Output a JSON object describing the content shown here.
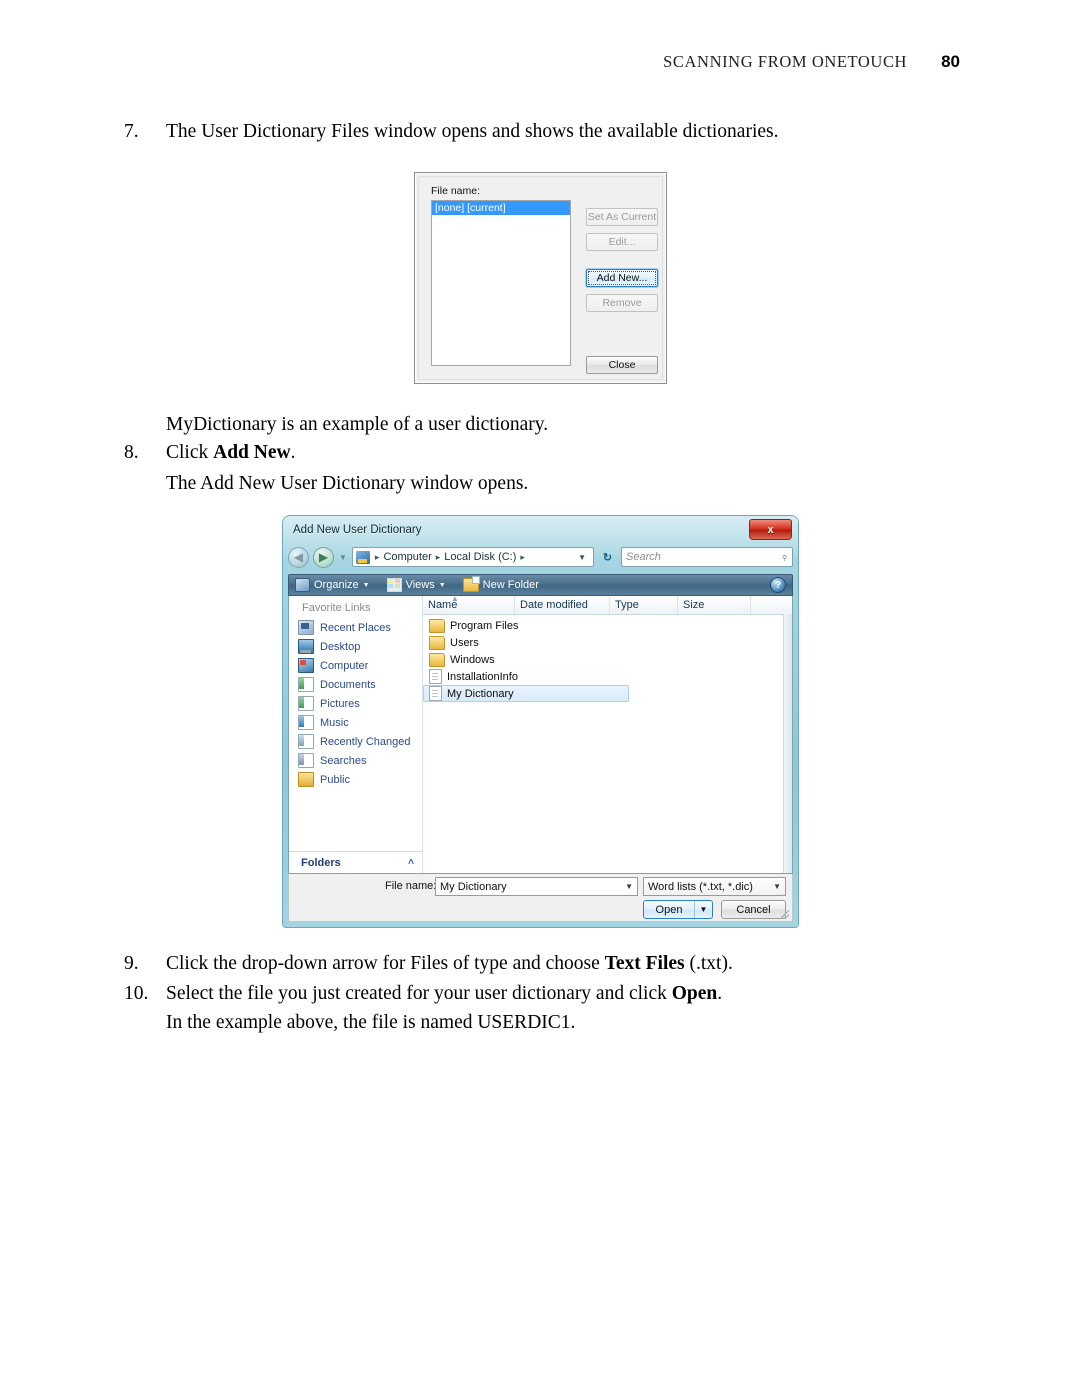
{
  "header": {
    "title": "SCANNING FROM ONETOUCH",
    "page_number": "80"
  },
  "steps": {
    "step7_num": "7.",
    "step7_text": "The User Dictionary Files window opens and shows the available dictionaries.",
    "mydictionary_note": "MyDictionary is an example of a user dictionary.",
    "step8_num": "8.",
    "step8_text_pre": "Click ",
    "step8_text_bold": "Add New",
    "step8_text_post": ".",
    "step8_note": "The Add New User Dictionary window opens.",
    "step9_num": "9.",
    "step9_text_pre": "Click the drop-down arrow for Files of type and choose ",
    "step9_text_bold": "Text Files",
    "step9_text_post": " (.txt).",
    "step10_num": "10.",
    "step10_text_pre": "Select the file you just created for your user dictionary and click ",
    "step10_text_bold": "Open",
    "step10_text_post": ".",
    "step10_note": "In the example above, the file is named USERDIC1."
  },
  "dictionary_dialog": {
    "file_name_label": "File name:",
    "list_items": [
      "[none] [current]"
    ],
    "buttons": {
      "set_as_current": "Set As Current",
      "edit": "Edit...",
      "add_new": "Add New...",
      "remove": "Remove",
      "close": "Close"
    }
  },
  "file_dialog": {
    "title": "Add New User Dictionary",
    "close_glyph": "x",
    "address": {
      "crumbs": [
        "Computer",
        "Local Disk (C:)"
      ],
      "separator": "▸",
      "dropdown_glyph": "▼",
      "refresh_glyph": "↻"
    },
    "search": {
      "placeholder": "Search",
      "icon_glyph": "⌕"
    },
    "toolbar": {
      "organize": "Organize",
      "views": "Views",
      "new_folder": "New Folder",
      "caret_glyph": "▼",
      "help_glyph": "?"
    },
    "sidebar": {
      "title": "Favorite Links",
      "items": [
        {
          "label": "Recent Places",
          "icon": "recent-places-icon"
        },
        {
          "label": "Desktop",
          "icon": "desktop-icon"
        },
        {
          "label": "Computer",
          "icon": "computer-icon"
        },
        {
          "label": "Documents",
          "icon": "documents-icon"
        },
        {
          "label": "Pictures",
          "icon": "pictures-icon"
        },
        {
          "label": "Music",
          "icon": "music-icon"
        },
        {
          "label": "Recently Changed",
          "icon": "recently-changed-icon"
        },
        {
          "label": "Searches",
          "icon": "searches-icon"
        },
        {
          "label": "Public",
          "icon": "public-folder-icon"
        }
      ],
      "folders_label": "Folders",
      "folders_chevron": "˄"
    },
    "columns": [
      "Name",
      "Date modified",
      "Type",
      "Size"
    ],
    "files": [
      {
        "name": "Program Files",
        "kind": "folder",
        "selected": false
      },
      {
        "name": "Users",
        "kind": "folder",
        "selected": false
      },
      {
        "name": "Windows",
        "kind": "folder",
        "selected": false
      },
      {
        "name": "InstallationInfo",
        "kind": "document",
        "selected": false
      },
      {
        "name": "My Dictionary",
        "kind": "document",
        "selected": true
      }
    ],
    "footer": {
      "file_name_label": "File name:",
      "file_name_value": "My Dictionary",
      "file_type_value": "Word lists (*.txt, *.dic)",
      "open_label": "Open",
      "open_caret": "▼",
      "cancel_label": "Cancel",
      "caret_glyph": "▼"
    }
  },
  "colors": {
    "selection_blue": "#3399ff",
    "link_blue": "#2a4b8d",
    "glass_teal": "#9ccfdd",
    "close_red": "#d6321f"
  }
}
